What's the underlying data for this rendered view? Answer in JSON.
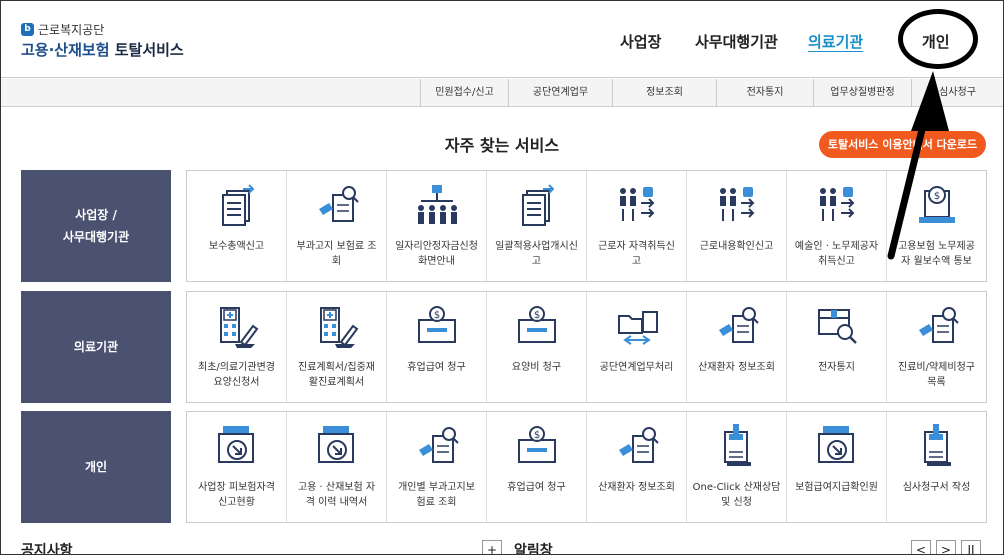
{
  "brand": {
    "org": "근로복지공단",
    "mark": "b",
    "service_part1": "고용·산재보험",
    "service_part2": "토탈서비스"
  },
  "gnb": [
    {
      "label": "사업장",
      "active": false
    },
    {
      "label": "사무대행기관",
      "active": false
    },
    {
      "label": "의료기관",
      "active": true
    },
    {
      "label": "개인",
      "active": false
    }
  ],
  "subnav": [
    "민원접수/신고",
    "공단연계업무",
    "정보조회",
    "전자통지",
    "업무상질병판정",
    "심사청구"
  ],
  "section_title": "자주 찾는 서비스",
  "download_button": "토탈서비스 이용안내서 다운로드",
  "rows": [
    {
      "label": "사업장 /\n사무대행기관",
      "items": [
        {
          "label": "보수총액신고",
          "icon": "document-arrow-icon"
        },
        {
          "label": "부과고지 보험료 조\n회",
          "icon": "search-document-icon"
        },
        {
          "label": "일자리안정자금신청\n화면안내",
          "icon": "org-chart-icon"
        },
        {
          "label": "일괄적용사업개시신\n고",
          "icon": "document-arrow-icon"
        },
        {
          "label": "근로자 자격취득신\n고",
          "icon": "people-list-icon"
        },
        {
          "label": "근로내용확인신고",
          "icon": "people-list-icon"
        },
        {
          "label": "예술인 · 노무제공자\n취득신고",
          "icon": "people-list-icon"
        },
        {
          "label": "고용보험 노무제공\n자 월보수액 통보",
          "icon": "money-laptop-icon"
        }
      ]
    },
    {
      "label": "의료기관",
      "items": [
        {
          "label": "최초/의료기관변경\n요양신청서",
          "icon": "hospital-sign-icon"
        },
        {
          "label": "진료계획서/집중재\n활진료계획서",
          "icon": "hospital-sign-icon"
        },
        {
          "label": "휴업급여 청구",
          "icon": "money-box-icon"
        },
        {
          "label": "요양비 청구",
          "icon": "money-box-icon"
        },
        {
          "label": "공단연계업무처리",
          "icon": "folder-exchange-icon"
        },
        {
          "label": "산재환자 정보조회",
          "icon": "search-document-icon"
        },
        {
          "label": "전자통지",
          "icon": "box-search-icon"
        },
        {
          "label": "진료비/약제비청구\n목록",
          "icon": "search-document-icon"
        }
      ]
    },
    {
      "label": "개인",
      "items": [
        {
          "label": "사업장 피보험자격\n신고현황",
          "icon": "tray-arrow-icon"
        },
        {
          "label": "고용 · 산재보험 자\n격 이력 내역서",
          "icon": "tray-arrow-icon"
        },
        {
          "label": "개인별 부과고지보\n험료 조회",
          "icon": "search-document-icon"
        },
        {
          "label": "휴업급여 청구",
          "icon": "money-box-icon"
        },
        {
          "label": "산재환자 정보조회",
          "icon": "search-document-icon"
        },
        {
          "label": "One-Click 산재상담\n및 신청",
          "icon": "stamp-document-icon"
        },
        {
          "label": "보험급여지급확인원",
          "icon": "tray-arrow-icon"
        },
        {
          "label": "심사청구서 작성",
          "icon": "stamp-document-icon"
        }
      ]
    }
  ],
  "bottom": {
    "notice_title": "공지사항",
    "notice_more": "+",
    "alarm_title": "알림창",
    "prev": "<",
    "next": ">",
    "pause": "II"
  },
  "colors": {
    "accent_blue": "#1a8fc7",
    "row_label_bg": "#4a5270",
    "download_orange": "#f05a1e",
    "icon_navy": "#2a3a5e",
    "icon_blue": "#3a8fd8"
  }
}
